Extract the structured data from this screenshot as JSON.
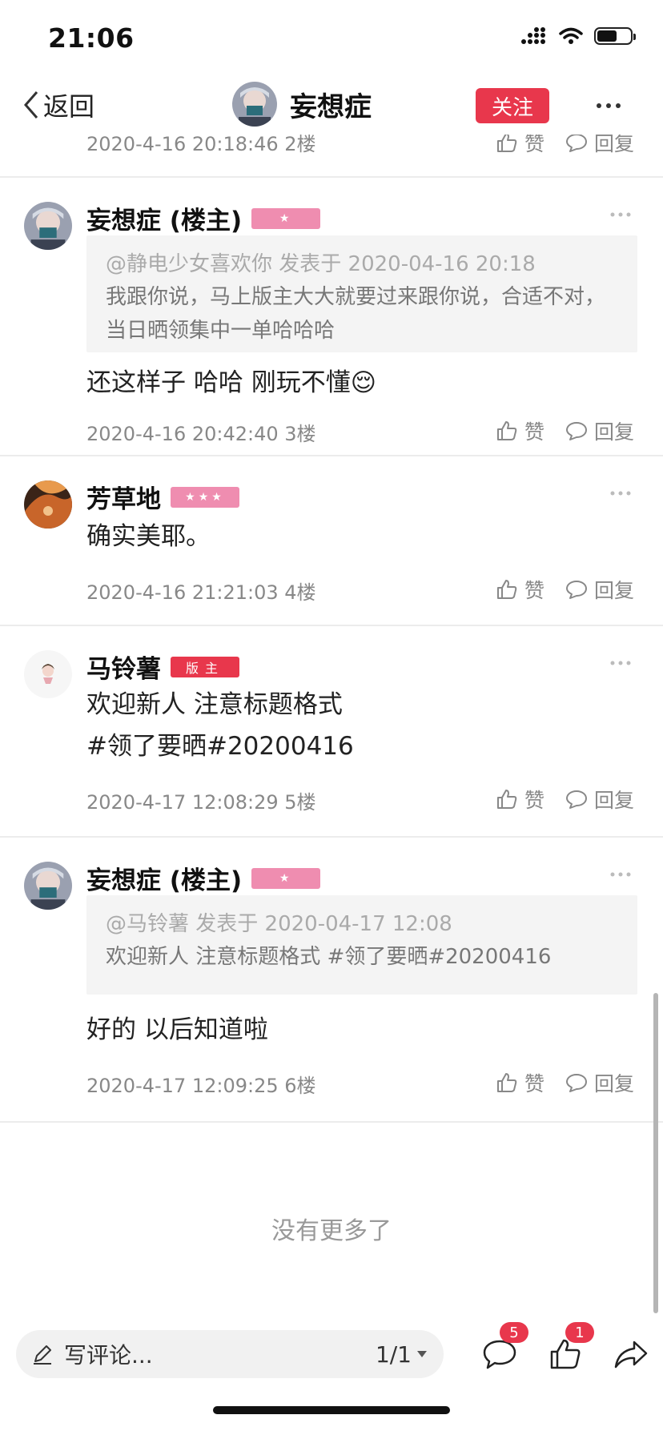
{
  "status_bar": {
    "time": "21:06",
    "battery_level": 0.6
  },
  "nav": {
    "back_label": "返回",
    "title": "妄想症",
    "follow_label": "关注"
  },
  "prev_item": {
    "meta": "2020-4-16 20:18:46  2楼",
    "like_label": "赞",
    "reply_label": "回复"
  },
  "comments": [
    {
      "name": "妄想症 (楼主)",
      "badge": "★",
      "quote_head": "@静电少女喜欢你  发表于 2020-04-16 20:18",
      "quote_body": "我跟你说，马上版主大大就要过来跟你说，合适不对，当日晒领集中一单哈哈哈",
      "text": "还这样子 哈哈 刚玩不懂😌",
      "meta": "2020-4-16 20:42:40  3楼",
      "like_label": "赞",
      "reply_label": "回复"
    },
    {
      "name": "芳草地",
      "badge": "★★★",
      "text": "确实美耶。",
      "meta": "2020-4-16 21:21:03  4楼",
      "like_label": "赞",
      "reply_label": "回复"
    },
    {
      "name": "马铃薯",
      "badge": "版主",
      "text_line1": "欢迎新人 注意标题格式",
      "text_line2": "#领了要晒#20200416",
      "meta": "2020-4-17 12:08:29  5楼",
      "like_label": "赞",
      "reply_label": "回复"
    },
    {
      "name": "妄想症 (楼主)",
      "badge": "★",
      "quote_head": "@马铃薯  发表于 2020-04-17 12:08",
      "quote_body": "欢迎新人 注意标题格式 #领了要晒#20200416",
      "text": "好的 以后知道啦",
      "meta": "2020-4-17 12:09:25  6楼",
      "like_label": "赞",
      "reply_label": "回复"
    }
  ],
  "end_text": "没有更多了",
  "bottom_bar": {
    "placeholder": "写评论...",
    "page": "1/1",
    "comment_count": "5",
    "like_count": "1"
  },
  "colors": {
    "accent": "#e8374c",
    "badge_pink": "#ef8db0"
  }
}
